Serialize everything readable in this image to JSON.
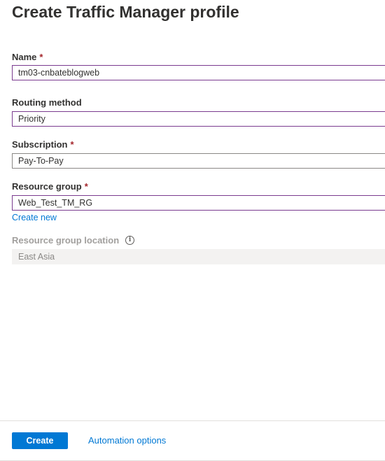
{
  "page": {
    "title": "Create Traffic Manager profile"
  },
  "form": {
    "name": {
      "label": "Name",
      "required_mark": "*",
      "value": "tm03-cnbateblogweb"
    },
    "routing_method": {
      "label": "Routing method",
      "value": "Priority"
    },
    "subscription": {
      "label": "Subscription",
      "required_mark": "*",
      "value": "Pay-To-Pay"
    },
    "resource_group": {
      "label": "Resource group",
      "required_mark": "*",
      "value": "Web_Test_TM_RG",
      "create_new_link": "Create new"
    },
    "resource_group_location": {
      "label": "Resource group location",
      "info_icon": "info-icon",
      "value": "East Asia"
    }
  },
  "footer": {
    "create_label": "Create",
    "automation_label": "Automation options"
  },
  "colors": {
    "accent": "#0078d4",
    "required": "#a4262c",
    "focus_border": "#7a3b8f",
    "disabled_bg": "#f3f2f1"
  }
}
